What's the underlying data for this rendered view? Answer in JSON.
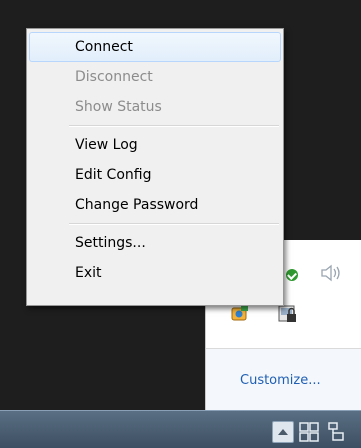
{
  "menu": {
    "items": [
      {
        "label": "Connect",
        "disabled": false,
        "highlight": true
      },
      {
        "label": "Disconnect",
        "disabled": true
      },
      {
        "label": "Show Status",
        "disabled": true
      },
      {
        "label": "View Log",
        "disabled": false
      },
      {
        "label": "Edit Config",
        "disabled": false
      },
      {
        "label": "Change Password",
        "disabled": false
      },
      {
        "label": "Settings...",
        "disabled": false
      },
      {
        "label": "Exit",
        "disabled": false
      }
    ]
  },
  "tray_flyout": {
    "customize_label": "Customize...",
    "icons": [
      "shield-check-icon",
      "speaker-icon",
      "openvpn-icon",
      "lock-icon"
    ]
  },
  "taskbar": {
    "icons": [
      "show-hidden-icons-icon",
      "windows-icon",
      "network-icon"
    ]
  },
  "colors": {
    "menu_bg": "#f0f0f0",
    "highlight_border": "#b8d6fb",
    "link": "#1e5fb4",
    "disabled_text": "#8c8c8c"
  }
}
